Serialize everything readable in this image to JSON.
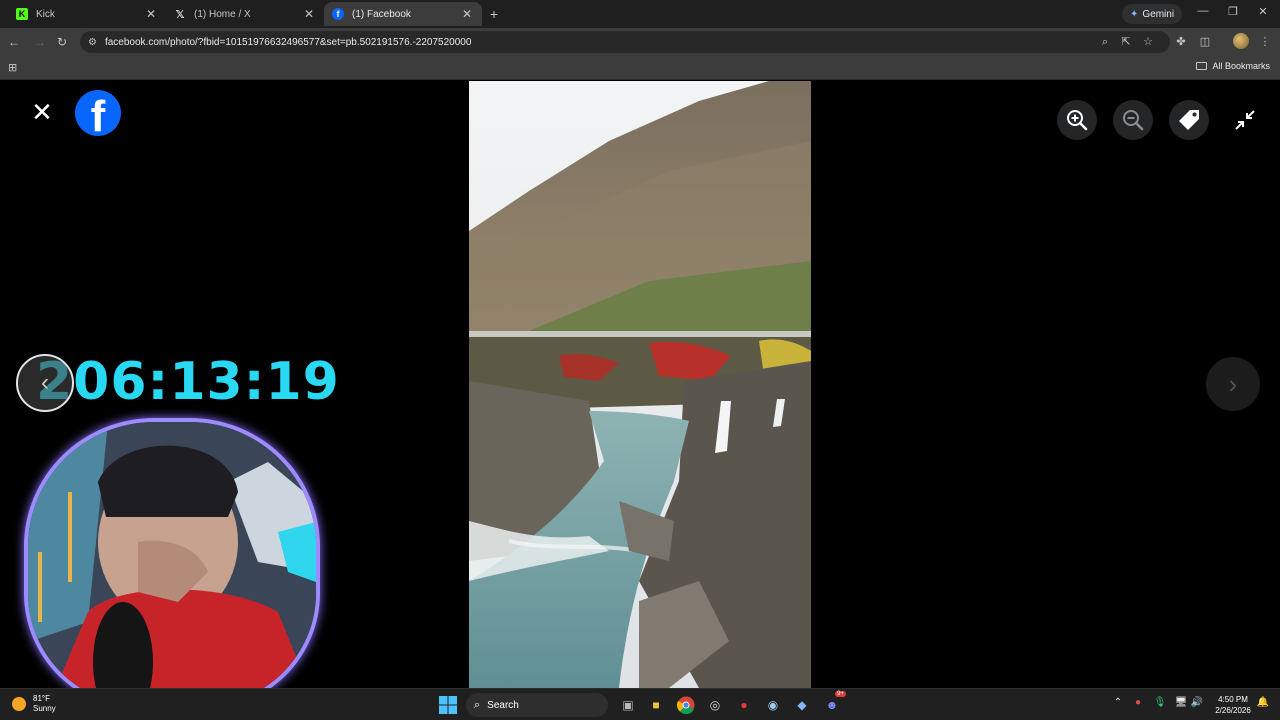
{
  "browser": {
    "tabs": [
      {
        "title": "Kick",
        "icon": "kick-favicon",
        "active": false
      },
      {
        "title": "(1) Home / X",
        "icon": "x-favicon",
        "active": false
      },
      {
        "title": "(1) Facebook",
        "icon": "facebook-favicon",
        "active": true
      }
    ],
    "new_tab_icon": "plus-icon",
    "gemini_label": "Gemini",
    "url": "facebook.com/photo/?fbid=10151976632496577&set=pb.502191576.-2207520000",
    "bookmarks_label": "All Bookmarks"
  },
  "viewer": {
    "close_icon": "close-icon",
    "logo": "facebook-logo",
    "zoom_in_icon": "zoom-in-icon",
    "zoom_out_icon": "zoom-out-icon",
    "tag_icon": "tag-icon",
    "exit_fullscreen_icon": "exit-fullscreen-icon",
    "next_icon": "chevron-right-icon",
    "prev_icon": "chevron-left-icon",
    "photo_alt": "river-gorge-photo"
  },
  "stream_overlay": {
    "timer": "206:13:19"
  },
  "taskbar": {
    "weather_temp": "81°F",
    "weather_desc": "Sunny",
    "search_label": "Search",
    "time": "4:50 PM",
    "date": "2/26/2026",
    "discord_badge": "9+"
  },
  "colors": {
    "facebook_blue": "#0866ff",
    "timer_cyan": "#29d9f4",
    "webcam_border": "#9c8cff"
  }
}
